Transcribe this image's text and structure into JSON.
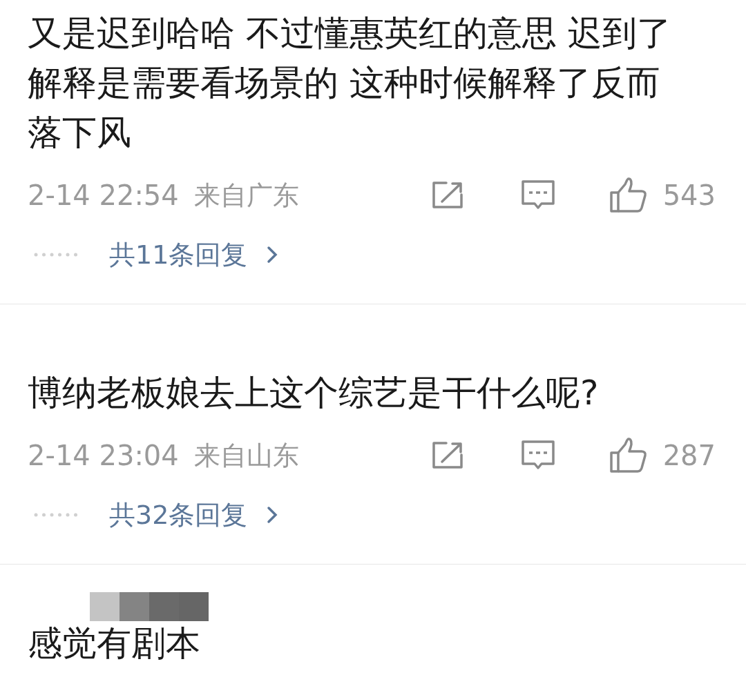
{
  "comments": [
    {
      "kind": "plain",
      "text": "又是迟到哈哈 不过懂惠英红的意思 迟到了解释是需要看场景的 这种时候解释了反而落下风",
      "date": "2-14 22:54",
      "location": "来自广东",
      "likes": "543",
      "replies": "共11条回复"
    },
    {
      "kind": "hidden-name",
      "text": "博纳老板娘去上这个综艺是干什么呢?",
      "date": "2-14 23:04",
      "location": "来自山东",
      "likes": "287",
      "replies": "共32条回复"
    },
    {
      "kind": "pixelated-name",
      "text": "感觉有剧本"
    }
  ]
}
